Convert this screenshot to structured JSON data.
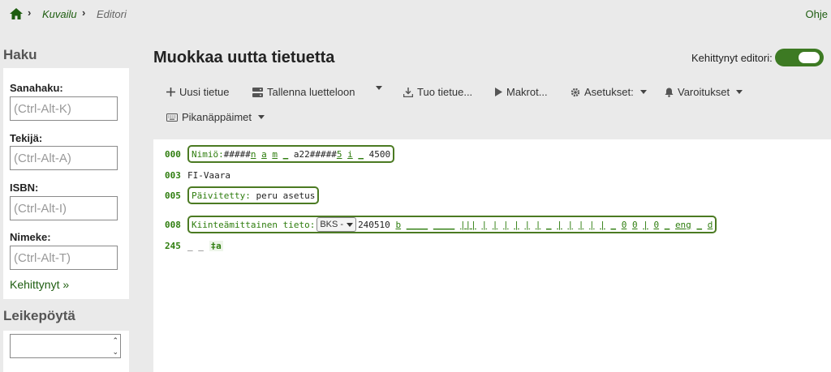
{
  "breadcrumb": {
    "items": [
      "Kuvailu",
      "Editori"
    ]
  },
  "help_link": "Ohje",
  "sidebar": {
    "search_heading": "Haku",
    "fields": [
      {
        "label": "Sanahaku:",
        "placeholder": "(Ctrl-Alt-K)"
      },
      {
        "label": "Tekijä:",
        "placeholder": "(Ctrl-Alt-A)"
      },
      {
        "label": "ISBN:",
        "placeholder": "(Ctrl-Alt-I)"
      },
      {
        "label": "Nimeke:",
        "placeholder": "(Ctrl-Alt-T)"
      }
    ],
    "advanced_link": "Kehittynyt »",
    "clipboard_heading": "Leikepöytä"
  },
  "main": {
    "title": "Muokkaa uutta tietuetta",
    "advanced_editor_label": "Kehittynyt editori:",
    "advanced_editor_on": true,
    "toolbar": {
      "new_record": "Uusi tietue",
      "save": "Tallenna luetteloon",
      "import": "Tuo tietue...",
      "macros": "Makrot...",
      "settings": "Asetukset:",
      "warnings": "Varoitukset",
      "shortcuts": "Pikanäppäimet"
    }
  },
  "editor": {
    "lines": [
      {
        "tag": "000",
        "label": "Nimiö:",
        "value_parts": [
          "#####",
          "n",
          "a",
          "m",
          "_",
          "a22#####",
          "5",
          "i",
          "_",
          "4500"
        ]
      },
      {
        "tag": "003",
        "value": "FI-Vaara"
      },
      {
        "tag": "005",
        "label": "Päivitetty:",
        "value": "peru asetus"
      },
      {
        "tag": "008",
        "label": "Kiinteämittainen tieto:",
        "select": "BKS -",
        "value_parts": [
          "240510",
          "b",
          "____",
          "____",
          "|||",
          "|",
          "|",
          "|",
          "|",
          "|",
          "|",
          "_",
          "|",
          "|",
          "|",
          "|",
          "|",
          "_",
          "0",
          "0",
          "|",
          "0",
          "_",
          "eng",
          "_",
          "d"
        ]
      },
      {
        "tag": "245",
        "indicators": [
          "_",
          "_"
        ],
        "subfield": "‡a"
      }
    ]
  },
  "colors": {
    "accent": "#1e5d10",
    "toggle": "#3d7a23",
    "tag_green": "#2e7d0e",
    "background": "#eaeaea"
  }
}
